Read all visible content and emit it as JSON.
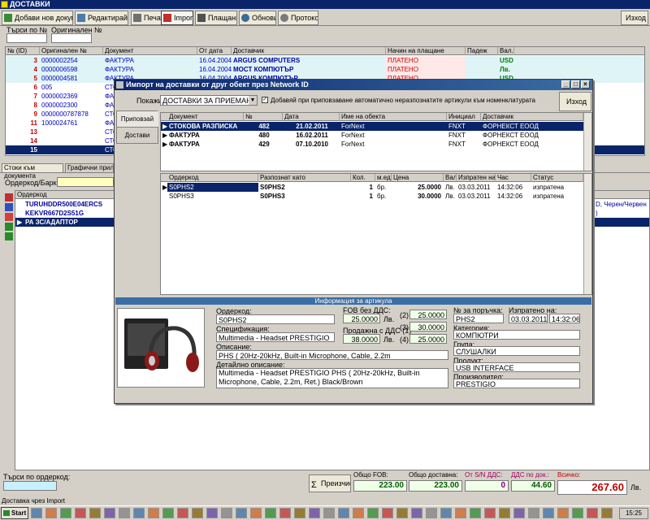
{
  "window": {
    "title": "ДОСТАВКИ"
  },
  "toolbar": {
    "add_label": "Добави нов документ",
    "edit_label": "Редактирай",
    "print_label": "Печат",
    "import_label": "Import",
    "payments_label": "Плащания",
    "refresh_label": "Обнови",
    "protocol_label": "Протокол",
    "exit_label": "Изход"
  },
  "search": {
    "by_no_label": "Търси по №",
    "original_no_label": "Оригинален №"
  },
  "main_grid": {
    "columns": [
      "№ (ID)",
      "Оригинален №",
      "Документ",
      "От дата",
      "Доставчик",
      "Начин на плащане",
      "Падеж",
      "Вал."
    ],
    "rows": [
      {
        "id": "3",
        "orig": "0000002254",
        "doc": "ФАКТУРА",
        "date": "16.04.2004",
        "supplier": "ARGUS COMPUTERS",
        "pay": "ПЛАТЕНО",
        "due": "",
        "cur": "USD"
      },
      {
        "id": "4",
        "orig": "0000006598",
        "doc": "ФАКТУРА",
        "date": "16.04.2004",
        "supplier": "МОСТ КОМПЮТЪР",
        "pay": "ПЛАТЕНО",
        "due": "",
        "cur": "Лв."
      },
      {
        "id": "5",
        "orig": "0000004581",
        "doc": "ФАКТУРА",
        "date": "16.04.2004",
        "supplier": "ARGUS КОМПЮТЪР",
        "pay": "ПЛАТЕНО",
        "due": "",
        "cur": "USD"
      },
      {
        "id": "6",
        "orig": "005",
        "doc": "СТО",
        "date": "",
        "supplier": "",
        "pay": "",
        "due": "",
        "cur": ""
      },
      {
        "id": "7",
        "orig": "0000002369",
        "doc": "ФА",
        "date": "",
        "supplier": "",
        "pay": "",
        "due": "",
        "cur": ""
      },
      {
        "id": "8",
        "orig": "0000002300",
        "doc": "ФА",
        "date": "",
        "supplier": "",
        "pay": "",
        "due": "",
        "cur": ""
      },
      {
        "id": "9",
        "orig": "0000000787878",
        "doc": "СТО",
        "date": "",
        "supplier": "",
        "pay": "",
        "due": "",
        "cur": ""
      },
      {
        "id": "11",
        "orig": "1000024761",
        "doc": "ФА",
        "date": "",
        "supplier": "",
        "pay": "",
        "due": "",
        "cur": ""
      },
      {
        "id": "13",
        "orig": "",
        "doc": "СТО",
        "date": "",
        "supplier": "",
        "pay": "",
        "due": "",
        "cur": ""
      },
      {
        "id": "14",
        "orig": "",
        "doc": "СТО",
        "date": "",
        "supplier": "",
        "pay": "",
        "due": "",
        "cur": ""
      },
      {
        "id": "15",
        "orig": "",
        "doc": "СТО",
        "date": "",
        "supplier": "",
        "pay": "",
        "due": "",
        "cur": ""
      }
    ]
  },
  "lower_tabs": {
    "items_tab": "Стоки към документа",
    "graphs_tab": "Графични прилож"
  },
  "barcode": {
    "label": "Ордеркод/Баркод:"
  },
  "items_grid": {
    "header": "Ордеркод",
    "rows": [
      "TURUHDDR500E04ERCS",
      "KEKVR667D2S51G",
      "РА ЗС/АДАПТОР"
    ],
    "right_text": [
      "D, Черен/Червен",
      ")"
    ]
  },
  "dialog": {
    "title": "Импорт на доставки от друг обект през Network ID",
    "tab_receive": "Приповзай",
    "tab_deliveries": "Достави",
    "show_label": "Покажи:",
    "show_value": "ДОСТАВКИ ЗА ПРИЕМАНЕ",
    "auto_add_label": "Добавяй при приповзаване автоматично неразпознатите артикули към номенклатурата",
    "exit_label": "Изход",
    "docs_columns": [
      "Документ",
      "№",
      "Дата",
      "Име на обекта",
      "Инициал",
      "Доставчик"
    ],
    "docs_rows": [
      {
        "doc": "СТОКОВА РАЗПИСКА",
        "no": "482",
        "date": "21.02.2011",
        "site": "ForNext",
        "init": "FNXT",
        "supplier": "ФОРНЕКСТ ЕООД"
      },
      {
        "doc": "ФАКТУРА",
        "no": "480",
        "date": "16.02.2011",
        "site": "ForNext",
        "init": "FNXT",
        "supplier": "ФОРНЕКСТ ЕООД"
      },
      {
        "doc": "ФАКТУРА",
        "no": "429",
        "date": "07.10.2010",
        "site": "ForNext",
        "init": "FNXT",
        "supplier": "ФОРНЕКСТ ЕООД"
      }
    ],
    "lines_columns": [
      "Ордеркод",
      "Разпознат като",
      "Кол.",
      "м.ед.",
      "Цена",
      "Вал.",
      "Изпратен на",
      "Час",
      "Статус"
    ],
    "lines_rows": [
      {
        "code": "S0PHS2",
        "as": "S0PHS2",
        "qty": "1",
        "unit": "бр.",
        "price": "25.0000",
        "cur": "Лв.",
        "sent": "03.03.2011",
        "time": "14:32:06",
        "status": "изпратена"
      },
      {
        "code": "S0PHS3",
        "as": "S0PHS3",
        "qty": "1",
        "unit": "бр.",
        "price": "30.0000",
        "cur": "Лв.",
        "sent": "03.03.2011",
        "time": "14:32:06",
        "status": "изпратена"
      }
    ],
    "info": {
      "header": "Информация за артикула",
      "ordercode_label": "Ордеркод:",
      "ordercode": "S0PHS2",
      "spec_label": "Спецификация:",
      "spec": "Multimedia - Headset PRESTIGIO",
      "desc_label": "Описание:",
      "desc": "PHS ( 20Hz-20kHz, Built-in Microphone, Cable, 2.2m",
      "detail_label": "Детайлно описание:",
      "detail": "Multimedia - Headset PRESTIGIO PHS ( 20Hz-20kHz, Built-in Microphone, Cable, 2.2m, Ret.) Black/Brown",
      "fob_label": "FOB без ДДС:",
      "fob": "25.0000",
      "fob_cur": "Лв.",
      "sale_label": "Продажна с ДДС (1)",
      "sale": "38.0000",
      "sale_cur": "Лв.",
      "p2_label": "(2)",
      "p2": "25.0000",
      "p3_label": "(3)",
      "p3": "30.0000",
      "p4_label": "(4)",
      "p4": "25.0000",
      "order_no_label": "№ за поръчка:",
      "order_no": "PHS2",
      "sent_label": "Изпратено на:",
      "sent_date": "03.03.2011",
      "sent_time": "14:32:06",
      "cat_label": "Категория:",
      "cat": "КОМПЮТРИ",
      "group_label": "Група:",
      "group": "СЛУШАЛКИ",
      "product_label": "Продукт:",
      "product": "USB INTERFACE",
      "maker_label": "Производител:",
      "maker": "PRESTIGIO"
    }
  },
  "footer": {
    "search_label": "Търси по ордеркод:",
    "recalc_label": "Преизчисли",
    "fob_total_label": "Общо FOB:",
    "fob_total": "223.00",
    "delivery_total_label": "Общо доставна:",
    "delivery_total": "223.00",
    "sn_vat_label": "От S/N ДДС:",
    "sn_vat": "0",
    "vat_doc_label": "ДДС по док.:",
    "vat_doc": "44.60",
    "total_label": "Всичко:",
    "total": "267.60",
    "total_cur": "Лв."
  },
  "status_text": "Доставка чрез Import",
  "taskbar": {
    "start": "Start",
    "clock": "15:25"
  }
}
